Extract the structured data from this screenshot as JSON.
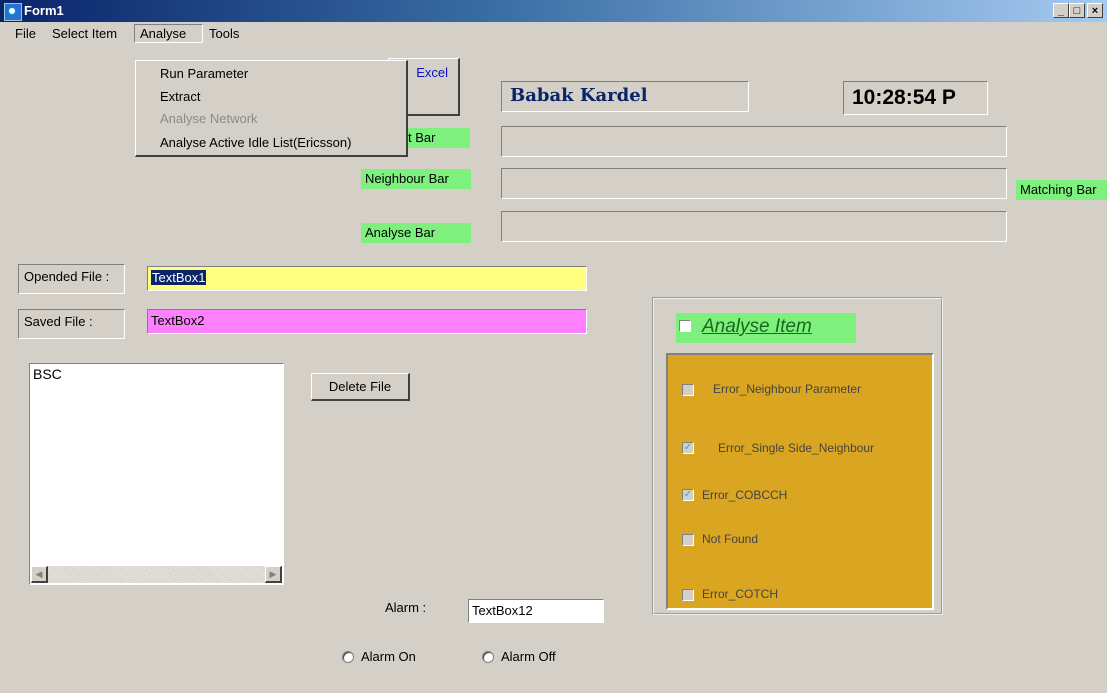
{
  "window": {
    "title": "Form1",
    "minimize": "_",
    "maximize": "□",
    "close": "×"
  },
  "menu": {
    "file": "File",
    "select_item": "Select Item",
    "analyse": "Analyse",
    "tools": "Tools"
  },
  "analyse_menu": {
    "run_parameter": "Run Parameter",
    "extract": "Extract",
    "analyse_network": "Analyse Network",
    "analyse_active_idle": "Analyse Active  Idle List(Ericsson)"
  },
  "excel_button": "Excel",
  "user_name": "Babak Kardel",
  "clock": "10:28:54 P",
  "labels": {
    "partial_bar": "t Bar",
    "neighbour_bar": "Neighbour Bar",
    "analyse_bar": "Analyse Bar",
    "matching_bar": "Matching Bar",
    "opened_file": "Opended File :",
    "saved_file": "Saved File :",
    "alarm": "Alarm :"
  },
  "textboxes": {
    "opened": "TextBox1",
    "saved": "TextBox2",
    "alarm": "TextBox12"
  },
  "listbox": {
    "items": [
      "BSC"
    ]
  },
  "delete_button": "Delete File",
  "radios": {
    "alarm_on": "Alarm On",
    "alarm_off": "Alarm Off"
  },
  "analyse_group": {
    "title": "Analyse Item",
    "items": [
      {
        "label": "Error_Neighbour Parameter",
        "checked": false
      },
      {
        "label": "Error_Single Side_Neighbour",
        "checked": true
      },
      {
        "label": "Error_COBCCH",
        "checked": true
      },
      {
        "label": "Not Found",
        "checked": false
      },
      {
        "label": "Error_COTCH",
        "checked": false
      }
    ]
  },
  "colors": {
    "green": "#7ef07e",
    "yellow": "#ffff80",
    "pink": "#ff80ff",
    "group_bg": "#daa520",
    "title_blue": "#0a246a"
  }
}
